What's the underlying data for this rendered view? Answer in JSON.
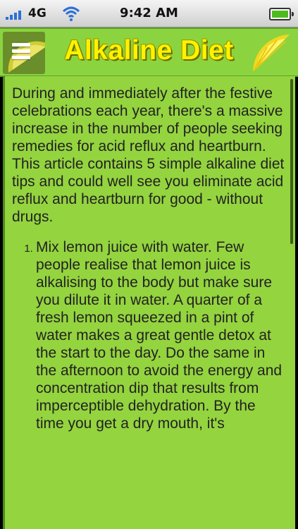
{
  "status_bar": {
    "carrier": "4G",
    "time": "9:42 AM",
    "icons": [
      "signal-icon",
      "wifi-icon",
      "battery-icon"
    ]
  },
  "header": {
    "title": "Alkaline Diet",
    "menu_icon": "hamburger-menu-icon",
    "logo_icon": "lemon-slice-icon"
  },
  "article": {
    "intro": "During and immediately after the festive celebrations each year, there's a massive increase in the number of people seeking remedies for acid reflux and heartburn. This article contains 5 simple alkaline diet tips and could well see you eliminate acid reflux and heartburn for good - without drugs.",
    "tips": [
      "Mix lemon juice with water. Few people realise that lemon juice is alkalising to the body but make sure you dilute it in water. A quarter of a fresh lemon squeezed in a pint of water makes a great gentle detox at the start to the day. Do the same in the afternoon to avoid the energy and concentration dip that results from imperceptible dehydration. By the time you get a dry mouth, it's"
    ]
  },
  "colors": {
    "background": "#94d43f",
    "title": "#fff200",
    "text": "#222222",
    "signal": "#2d6fd6",
    "battery": "#4dbb1e"
  }
}
